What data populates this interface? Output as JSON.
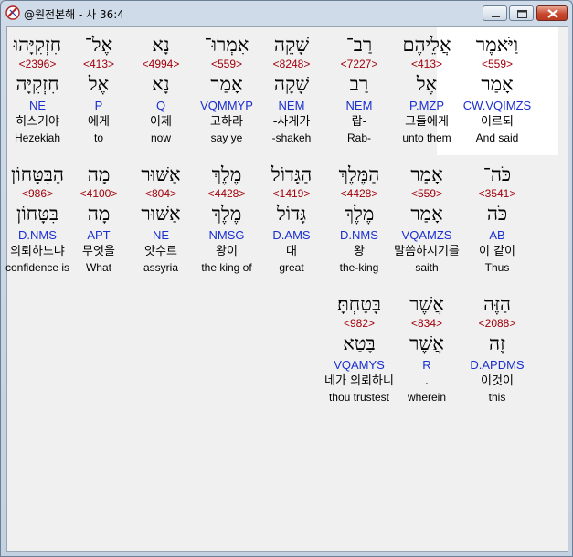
{
  "window": {
    "title": "@원전본해 - 사 36:4",
    "buttons": {
      "minimize": "minimize-icon",
      "maximize": "maximize-icon",
      "close": "close-icon"
    }
  },
  "colors": {
    "strong_number": "#a0000a",
    "morphology": "#1a2fcf",
    "highlight": "#ffffff"
  },
  "rows": [
    [
      {
        "heb": "וַיֹּאמֶר",
        "num": "<559>",
        "root": "אָמַר",
        "morph": "CW.VQIMZS",
        "kor": "이르되",
        "eng": "And said"
      },
      {
        "heb": "אֲלֵיהֶם",
        "num": "<413>",
        "root": "אֶל",
        "morph": "P.MZP",
        "kor": "그들에게",
        "eng": "unto them"
      },
      {
        "heb": "רַב־",
        "num": "<7227>",
        "root": "רַב",
        "morph": "NEM",
        "kor": "랍-",
        "eng": "Rab-"
      },
      {
        "heb": "שָׁקֵה",
        "num": "<8248>",
        "root": "שָׁקָה",
        "morph": "NEM",
        "kor": "-사게가",
        "eng": "-shakeh"
      },
      {
        "heb": "אִמְרוּ־",
        "num": "<559>",
        "root": "אָמַר",
        "morph": "VQMMYP",
        "kor": "고하라",
        "eng": "say ye"
      },
      {
        "heb": "נָא",
        "num": "<4994>",
        "root": "נָא",
        "morph": "Q",
        "kor": "이제",
        "eng": "now"
      },
      {
        "heb": "אֶל־",
        "num": "<413>",
        "root": "אֶל",
        "morph": "P",
        "kor": "에게",
        "eng": "to"
      },
      {
        "heb": "חִזְקִיָּהוּ",
        "num": "<2396>",
        "root": "חִזְקִיָּה",
        "morph": "NE",
        "kor": "히스기야",
        "eng": "Hezekiah"
      }
    ],
    [
      {
        "heb": "כֹּה־",
        "num": "<3541>",
        "root": "כֹּה",
        "morph": "AB",
        "kor": "이 같이",
        "eng": "Thus"
      },
      {
        "heb": "אָמַר",
        "num": "<559>",
        "root": "אָמַר",
        "morph": "VQAMZS",
        "kor": "말씀하시기를",
        "eng": "saith"
      },
      {
        "heb": "הַמֶּלֶךְ",
        "num": "<4428>",
        "root": "מֶלֶךְ",
        "morph": "D.NMS",
        "kor": "왕",
        "eng": "the-king"
      },
      {
        "heb": "הַגָּדוֹל",
        "num": "<1419>",
        "root": "גָּדוֹל",
        "morph": "D.AMS",
        "kor": "대",
        "eng": "great"
      },
      {
        "heb": "מֶלֶךְ",
        "num": "<4428>",
        "root": "מֶלֶךְ",
        "morph": "NMSG",
        "kor": "왕이",
        "eng": "the king of"
      },
      {
        "heb": "אַשּׁוּר",
        "num": "<804>",
        "root": "אַשּׁוּר",
        "morph": "NE",
        "kor": "앗수르",
        "eng": "assyria"
      },
      {
        "heb": "מָה",
        "num": "<4100>",
        "root": "מָה",
        "morph": "APT",
        "kor": "무엇을",
        "eng": "What"
      },
      {
        "heb": "הַבִּטָּחוֹן",
        "num": "<986>",
        "root": "בִּטָּחוֹן",
        "morph": "D.NMS",
        "kor": "의뢰하느냐",
        "eng": "confidence is"
      }
    ],
    [
      {
        "heb": "הַזֶּה",
        "num": "<2088>",
        "root": "זֶה",
        "morph": "D.APDMS",
        "kor": "이것이",
        "eng": "this"
      },
      {
        "heb": "אֲשֶׁר",
        "num": "<834>",
        "root": "אֲשֶׁר",
        "morph": "R",
        "kor": ".",
        "eng": "wherein"
      },
      {
        "heb": "בָּטָחְתָּ׃",
        "num": "<982>",
        "root": "בָּטַא",
        "morph": "VQAMYS",
        "kor": "네가 의뢰하니",
        "eng": "thou trustest"
      }
    ]
  ]
}
